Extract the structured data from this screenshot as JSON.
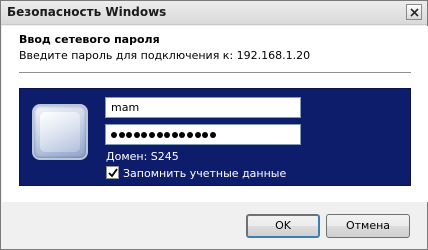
{
  "window": {
    "title": "Безопасность Windows",
    "close_label": "✕"
  },
  "header": {
    "heading": "Ввод сетевого пароля",
    "subheading": "Введите пароль для подключения к: 192.168.1.20"
  },
  "credentials": {
    "username": "mam",
    "password_dot_count": 14,
    "domain_text": "Домен: S245",
    "remember_label": "Запомнить учетные данные",
    "remember_checked": true,
    "panel_color": "#0e1d6b"
  },
  "buttons": {
    "ok_label": "OK",
    "cancel_label": "Отмена"
  },
  "icons": {
    "user_tile": "user-tile-icon",
    "close": "close-icon",
    "checkmark": "checkmark-icon"
  }
}
